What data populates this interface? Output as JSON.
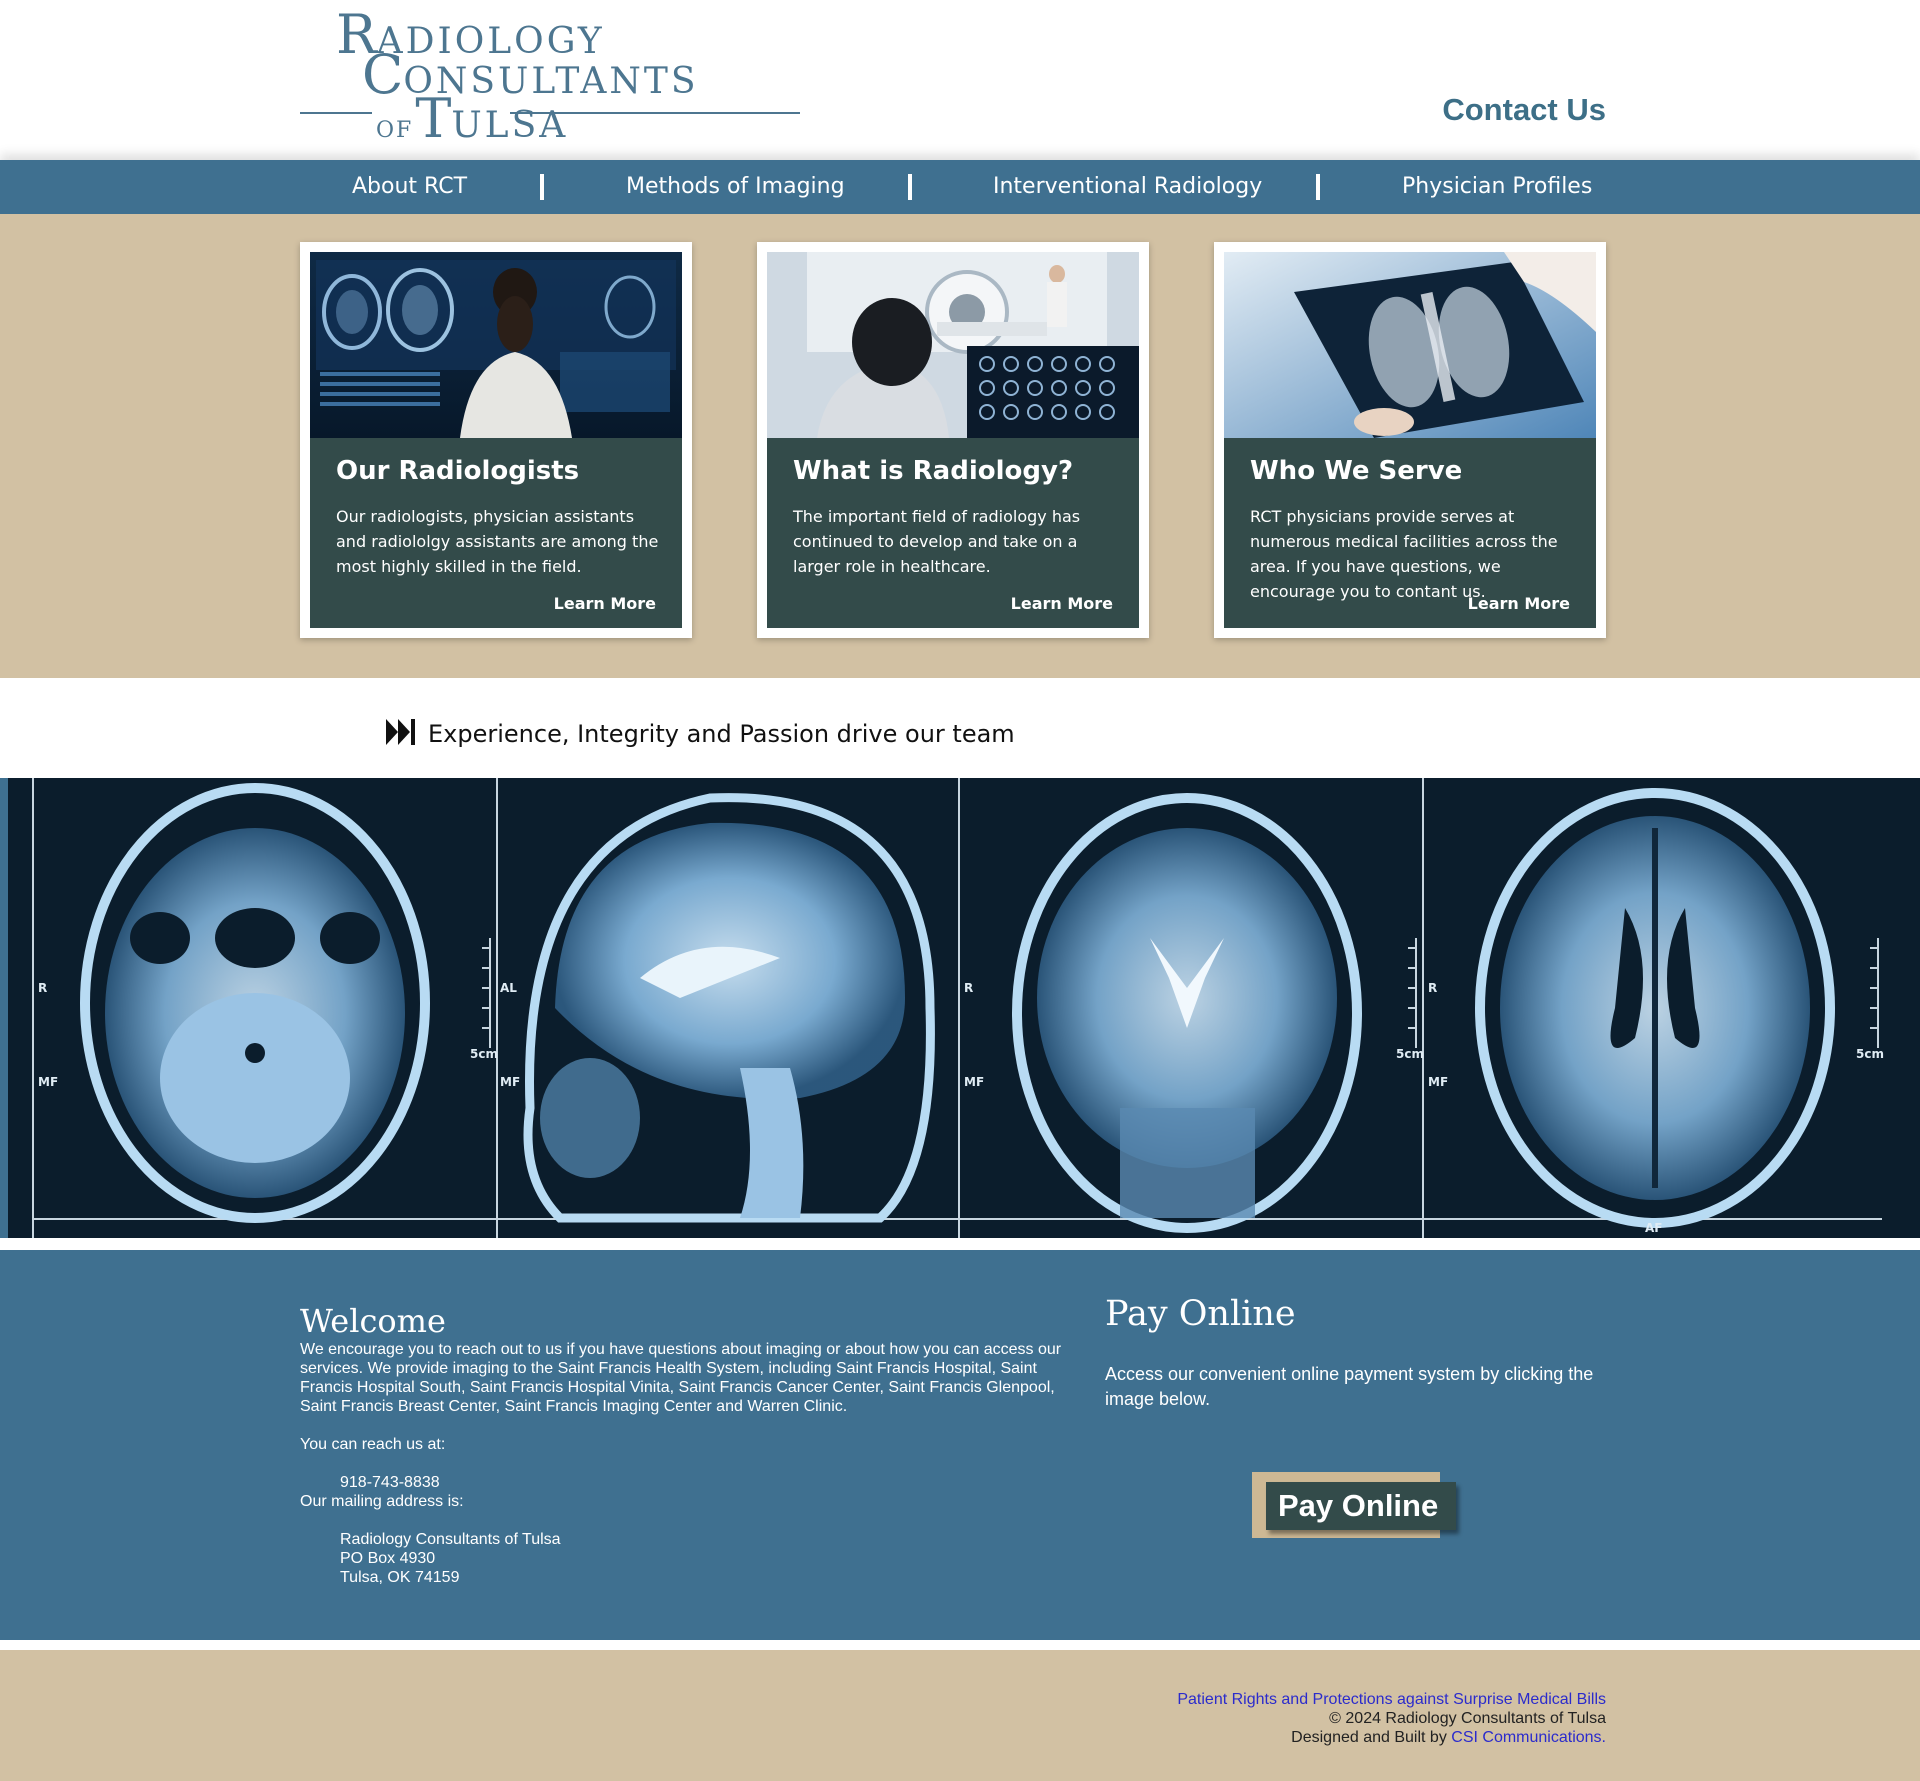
{
  "header": {
    "logo": {
      "line1_initial": "R",
      "line1_rest": "ADIOLOGY",
      "line2_initial": "C",
      "line2_rest": "ONSULTANTS",
      "line3_of": "OF",
      "line3_initial": "T",
      "line3_rest": "ULSA"
    },
    "contact_label": "Contact Us"
  },
  "nav": {
    "items": [
      {
        "label": "About RCT"
      },
      {
        "label": "Methods of Imaging"
      },
      {
        "label": "Interventional Radiology"
      },
      {
        "label": "Physician Profiles"
      }
    ]
  },
  "cards": [
    {
      "title": "Our Radiologists",
      "text": "Our radiologists, physician assistants and radiololgy assistants are among the most highly skilled in the field.",
      "link": "Learn More"
    },
    {
      "title": "What is Radiology?",
      "text": "The important field of radiology has continued to develop and take on a larger role in healthcare.",
      "link": "Learn More"
    },
    {
      "title": "Who We Serve",
      "text": "RCT physicians provide serves at numerous medical facilities across the area. If you have questions, we encourage you to contant us.",
      "link": "Learn More"
    }
  ],
  "tagline": {
    "text": "Experience, Integrity and Passion drive our team"
  },
  "mri_labels": {
    "r": "R",
    "mf": "MF",
    "al": "AL",
    "scale": "5cm",
    "af": "AF"
  },
  "welcome": {
    "title": "Welcome",
    "intro": "We encourage you to reach out to us if you have questions about imaging or about how you can access our services. We provide imaging to the Saint Francis Health System, including Saint Francis Hospital, Saint Francis Hospital South, Saint Francis Hospital Vinita, Saint Francis Cancer Center, Saint Francis Glenpool, Saint Francis Breast Center, Saint Francis Imaging Center and Warren Clinic.",
    "reach_label": "You can reach us at:",
    "phone": "918-743-8838",
    "mailing_label": "Our mailing address is:",
    "address_name": "Radiology Consultants of Tulsa",
    "address_box": "PO Box 4930",
    "address_city": "Tulsa, OK 74159"
  },
  "pay": {
    "title": "Pay Online",
    "text": "Access our convenient online payment system by clicking the image below.",
    "button_label": "Pay Online"
  },
  "footer": {
    "rights_link": "Patient Rights and Protections against Surprise Medical Bills",
    "copyright": "© 2024 Radiology Consultants of Tulsa",
    "designed_prefix": "Designed and Built by ",
    "designer_link": "CSI Communications."
  },
  "colors": {
    "primary_blue": "#3f7090",
    "tan": "#d2c1a3",
    "card_dark": "#334b4a",
    "link_blue": "#2b2bcc"
  }
}
